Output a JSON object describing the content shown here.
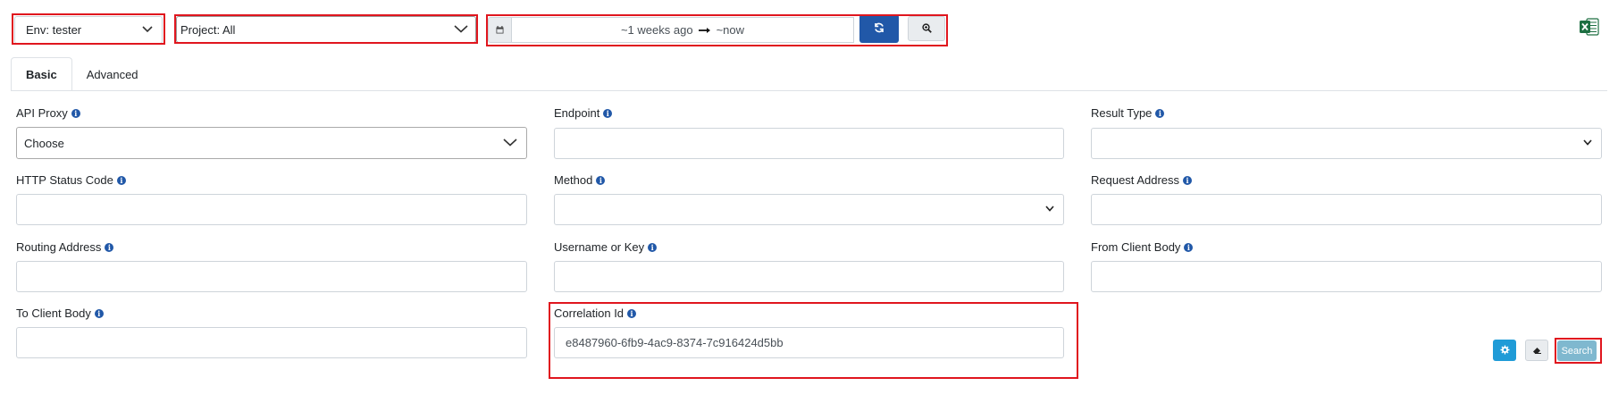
{
  "toolbar": {
    "env_label": "Env: tester",
    "project_label": "Project: All",
    "range_from": "~1 weeks ago",
    "range_to": "~now"
  },
  "tabs": [
    {
      "label": "Basic",
      "active": true
    },
    {
      "label": "Advanced",
      "active": false
    }
  ],
  "fields": {
    "api_proxy": {
      "label": "API Proxy",
      "value": "Choose"
    },
    "endpoint": {
      "label": "Endpoint",
      "value": ""
    },
    "result_type": {
      "label": "Result Type",
      "value": ""
    },
    "http_status_code": {
      "label": "HTTP Status Code",
      "value": ""
    },
    "method": {
      "label": "Method",
      "value": ""
    },
    "request_address": {
      "label": "Request Address",
      "value": ""
    },
    "routing_address": {
      "label": "Routing Address",
      "value": ""
    },
    "username_or_key": {
      "label": "Username or Key",
      "value": ""
    },
    "from_client_body": {
      "label": "From Client Body",
      "value": ""
    },
    "to_client_body": {
      "label": "To Client Body",
      "value": ""
    },
    "correlation_id": {
      "label": "Correlation Id",
      "value": "e8487960-6fb9-4ac9-8374-7c916424d5bb"
    }
  },
  "actions": {
    "search_label": "Search"
  },
  "icons": {
    "calendar": "calendar-icon",
    "refresh": "refresh-icon",
    "zoom": "zoom-icon",
    "excel": "excel-icon",
    "info": "info-icon",
    "gear": "gear-icon",
    "eraser": "eraser-icon",
    "chevron": "chevron-down-icon",
    "arrow": "arrow-right-icon"
  },
  "colors": {
    "primary": "#2158a8",
    "info_button": "#1f9bd7",
    "search_button": "#7fb8cf",
    "highlight": "#e0161e",
    "excel_green": "#1d6f42"
  }
}
